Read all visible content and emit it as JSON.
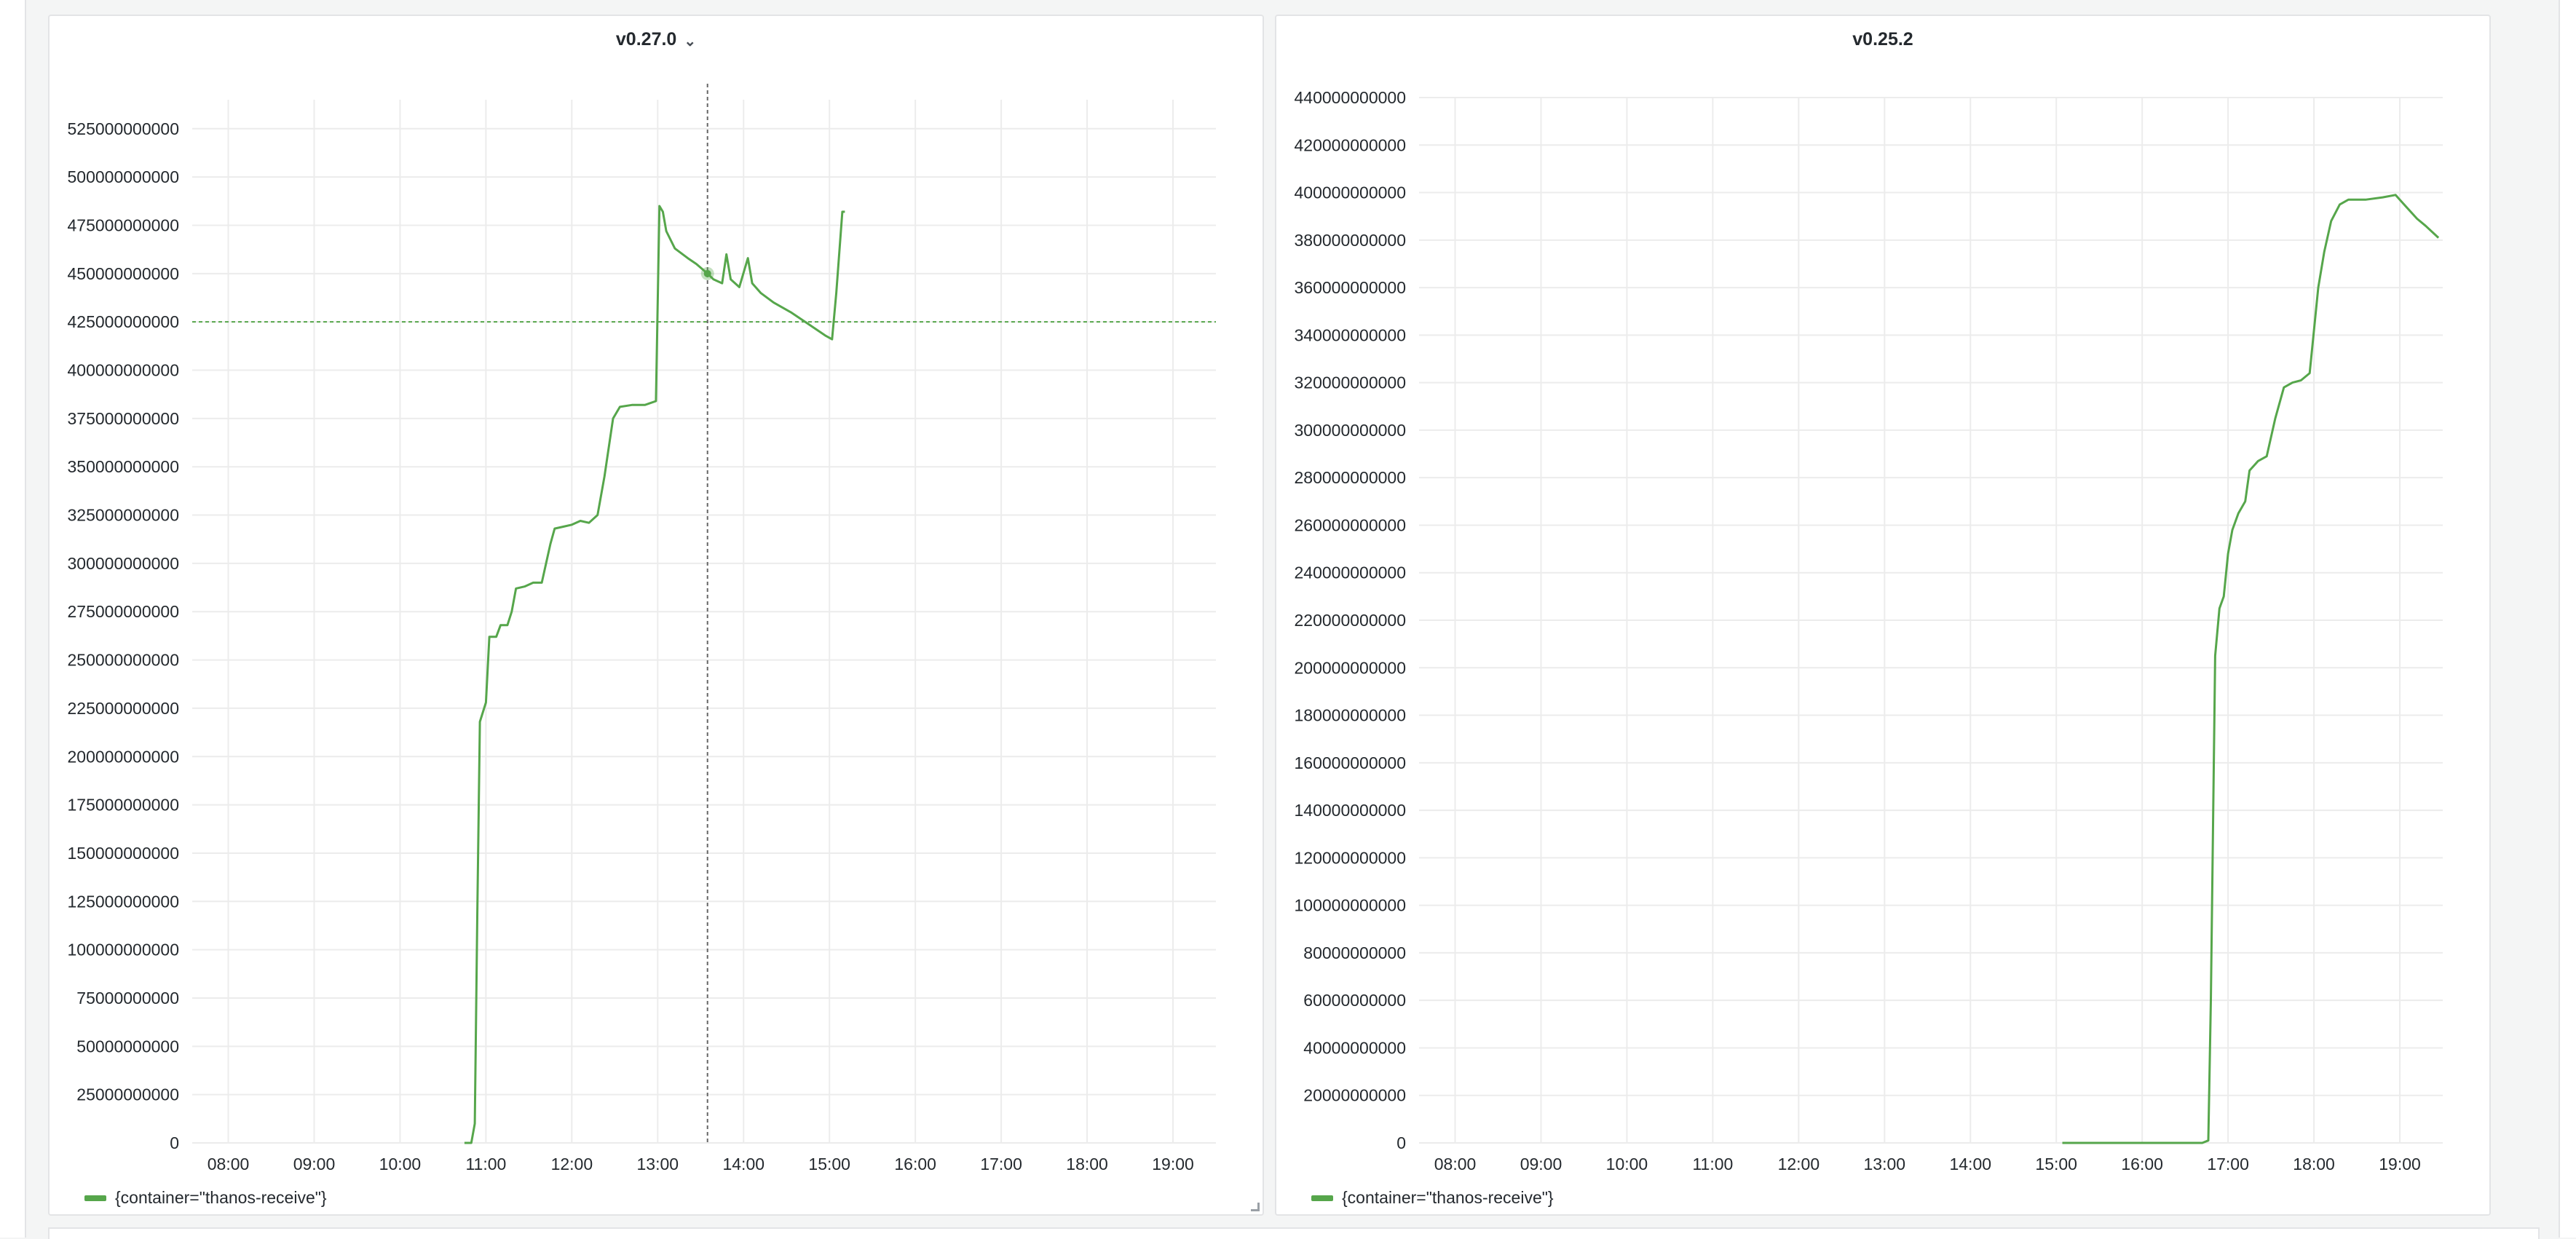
{
  "colors": {
    "series": "#56a64b",
    "grid": "#ececec",
    "text": "#24292e",
    "crosshair": "#666666",
    "threshold": "#56a64b"
  },
  "chart_data": [
    {
      "type": "line",
      "title": "v0.27.0",
      "title_menu_icon": "chevron-down-icon",
      "x_unit": "time (HH:MM)",
      "xlim": [
        7.58,
        19.5
      ],
      "ylim": [
        0,
        540000000000
      ],
      "x_ticks": [
        {
          "v": 8,
          "label": "08:00"
        },
        {
          "v": 9,
          "label": "09:00"
        },
        {
          "v": 10,
          "label": "10:00"
        },
        {
          "v": 11,
          "label": "11:00"
        },
        {
          "v": 12,
          "label": "12:00"
        },
        {
          "v": 13,
          "label": "13:00"
        },
        {
          "v": 14,
          "label": "14:00"
        },
        {
          "v": 15,
          "label": "15:00"
        },
        {
          "v": 16,
          "label": "16:00"
        },
        {
          "v": 17,
          "label": "17:00"
        },
        {
          "v": 18,
          "label": "18:00"
        },
        {
          "v": 19,
          "label": "19:00"
        }
      ],
      "y_ticks": [
        {
          "v": 0,
          "label": "0"
        },
        {
          "v": 25000000000,
          "label": "25000000000"
        },
        {
          "v": 50000000000,
          "label": "50000000000"
        },
        {
          "v": 75000000000,
          "label": "75000000000"
        },
        {
          "v": 100000000000,
          "label": "100000000000"
        },
        {
          "v": 125000000000,
          "label": "125000000000"
        },
        {
          "v": 150000000000,
          "label": "150000000000"
        },
        {
          "v": 175000000000,
          "label": "175000000000"
        },
        {
          "v": 200000000000,
          "label": "200000000000"
        },
        {
          "v": 225000000000,
          "label": "225000000000"
        },
        {
          "v": 250000000000,
          "label": "250000000000"
        },
        {
          "v": 275000000000,
          "label": "275000000000"
        },
        {
          "v": 300000000000,
          "label": "300000000000"
        },
        {
          "v": 325000000000,
          "label": "325000000000"
        },
        {
          "v": 350000000000,
          "label": "350000000000"
        },
        {
          "v": 375000000000,
          "label": "375000000000"
        },
        {
          "v": 400000000000,
          "label": "400000000000"
        },
        {
          "v": 425000000000,
          "label": "425000000000"
        },
        {
          "v": 450000000000,
          "label": "450000000000"
        },
        {
          "v": 475000000000,
          "label": "475000000000"
        },
        {
          "v": 500000000000,
          "label": "500000000000"
        },
        {
          "v": 525000000000,
          "label": "525000000000"
        }
      ],
      "crosshair": {
        "x": 13.58,
        "y": 425000000000,
        "point_y": 450000000000
      },
      "series": [
        {
          "name": "{container=\"thanos-receive\"}",
          "points": [
            [
              10.75,
              0
            ],
            [
              10.83,
              0
            ],
            [
              10.87,
              10000000000
            ],
            [
              10.9,
              120000000000
            ],
            [
              10.93,
              218000000000
            ],
            [
              11.0,
              228000000000
            ],
            [
              11.04,
              262000000000
            ],
            [
              11.12,
              262000000000
            ],
            [
              11.17,
              268000000000
            ],
            [
              11.25,
              268000000000
            ],
            [
              11.3,
              275000000000
            ],
            [
              11.35,
              287000000000
            ],
            [
              11.45,
              288000000000
            ],
            [
              11.55,
              290000000000
            ],
            [
              11.65,
              290000000000
            ],
            [
              11.75,
              310000000000
            ],
            [
              11.8,
              318000000000
            ],
            [
              11.9,
              319000000000
            ],
            [
              12.0,
              320000000000
            ],
            [
              12.1,
              322000000000
            ],
            [
              12.2,
              321000000000
            ],
            [
              12.3,
              325000000000
            ],
            [
              12.38,
              345000000000
            ],
            [
              12.48,
              375000000000
            ],
            [
              12.56,
              381000000000
            ],
            [
              12.7,
              382000000000
            ],
            [
              12.85,
              382000000000
            ],
            [
              12.98,
              384000000000
            ],
            [
              13.02,
              485000000000
            ],
            [
              13.06,
              482000000000
            ],
            [
              13.1,
              472000000000
            ],
            [
              13.2,
              463000000000
            ],
            [
              13.35,
              458000000000
            ],
            [
              13.45,
              455000000000
            ],
            [
              13.58,
              450000000000
            ],
            [
              13.65,
              447000000000
            ],
            [
              13.75,
              445000000000
            ],
            [
              13.8,
              460000000000
            ],
            [
              13.85,
              447000000000
            ],
            [
              13.95,
              443000000000
            ],
            [
              14.05,
              458000000000
            ],
            [
              14.1,
              445000000000
            ],
            [
              14.2,
              440000000000
            ],
            [
              14.35,
              435000000000
            ],
            [
              14.55,
              430000000000
            ],
            [
              14.75,
              424000000000
            ],
            [
              14.95,
              418000000000
            ],
            [
              15.03,
              416000000000
            ],
            [
              15.08,
              440000000000
            ],
            [
              15.15,
              482000000000
            ],
            [
              15.18,
              482000000000
            ]
          ]
        }
      ],
      "legend": {
        "position": "bottom-left",
        "items": [
          "{container=\"thanos-receive\"}"
        ]
      }
    },
    {
      "type": "line",
      "title": "v0.25.2",
      "x_unit": "time (HH:MM)",
      "xlim": [
        7.58,
        19.5
      ],
      "ylim": [
        0,
        440000000000
      ],
      "x_ticks": [
        {
          "v": 8,
          "label": "08:00"
        },
        {
          "v": 9,
          "label": "09:00"
        },
        {
          "v": 10,
          "label": "10:00"
        },
        {
          "v": 11,
          "label": "11:00"
        },
        {
          "v": 12,
          "label": "12:00"
        },
        {
          "v": 13,
          "label": "13:00"
        },
        {
          "v": 14,
          "label": "14:00"
        },
        {
          "v": 15,
          "label": "15:00"
        },
        {
          "v": 16,
          "label": "16:00"
        },
        {
          "v": 17,
          "label": "17:00"
        },
        {
          "v": 18,
          "label": "18:00"
        },
        {
          "v": 19,
          "label": "19:00"
        }
      ],
      "y_ticks": [
        {
          "v": 0,
          "label": "0"
        },
        {
          "v": 20000000000,
          "label": "20000000000"
        },
        {
          "v": 40000000000,
          "label": "40000000000"
        },
        {
          "v": 60000000000,
          "label": "60000000000"
        },
        {
          "v": 80000000000,
          "label": "80000000000"
        },
        {
          "v": 100000000000,
          "label": "100000000000"
        },
        {
          "v": 120000000000,
          "label": "120000000000"
        },
        {
          "v": 140000000000,
          "label": "140000000000"
        },
        {
          "v": 160000000000,
          "label": "160000000000"
        },
        {
          "v": 180000000000,
          "label": "180000000000"
        },
        {
          "v": 200000000000,
          "label": "200000000000"
        },
        {
          "v": 220000000000,
          "label": "220000000000"
        },
        {
          "v": 240000000000,
          "label": "240000000000"
        },
        {
          "v": 260000000000,
          "label": "260000000000"
        },
        {
          "v": 280000000000,
          "label": "280000000000"
        },
        {
          "v": 300000000000,
          "label": "300000000000"
        },
        {
          "v": 320000000000,
          "label": "320000000000"
        },
        {
          "v": 340000000000,
          "label": "340000000000"
        },
        {
          "v": 360000000000,
          "label": "360000000000"
        },
        {
          "v": 380000000000,
          "label": "380000000000"
        },
        {
          "v": 400000000000,
          "label": "400000000000"
        },
        {
          "v": 420000000000,
          "label": "420000000000"
        },
        {
          "v": 440000000000,
          "label": "440000000000"
        }
      ],
      "series": [
        {
          "name": "{container=\"thanos-receive\"}",
          "points": [
            [
              15.07,
              0
            ],
            [
              16.0,
              0
            ],
            [
              16.7,
              0
            ],
            [
              16.77,
              1000000000
            ],
            [
              16.8,
              60000000000
            ],
            [
              16.85,
              205000000000
            ],
            [
              16.9,
              225000000000
            ],
            [
              16.95,
              230000000000
            ],
            [
              17.0,
              248000000000
            ],
            [
              17.05,
              258000000000
            ],
            [
              17.12,
              265000000000
            ],
            [
              17.2,
              270000000000
            ],
            [
              17.25,
              283000000000
            ],
            [
              17.35,
              287000000000
            ],
            [
              17.45,
              289000000000
            ],
            [
              17.55,
              305000000000
            ],
            [
              17.65,
              318000000000
            ],
            [
              17.75,
              320000000000
            ],
            [
              17.85,
              321000000000
            ],
            [
              17.95,
              324000000000
            ],
            [
              18.05,
              360000000000
            ],
            [
              18.12,
              375000000000
            ],
            [
              18.2,
              388000000000
            ],
            [
              18.3,
              395000000000
            ],
            [
              18.4,
              397000000000
            ],
            [
              18.6,
              397000000000
            ],
            [
              18.8,
              398000000000
            ],
            [
              18.95,
              399000000000
            ],
            [
              19.05,
              395000000000
            ],
            [
              19.2,
              389000000000
            ],
            [
              19.3,
              386000000000
            ],
            [
              19.45,
              381000000000
            ]
          ]
        }
      ],
      "legend": {
        "position": "bottom-left",
        "items": [
          "{container=\"thanos-receive\"}"
        ]
      }
    }
  ]
}
